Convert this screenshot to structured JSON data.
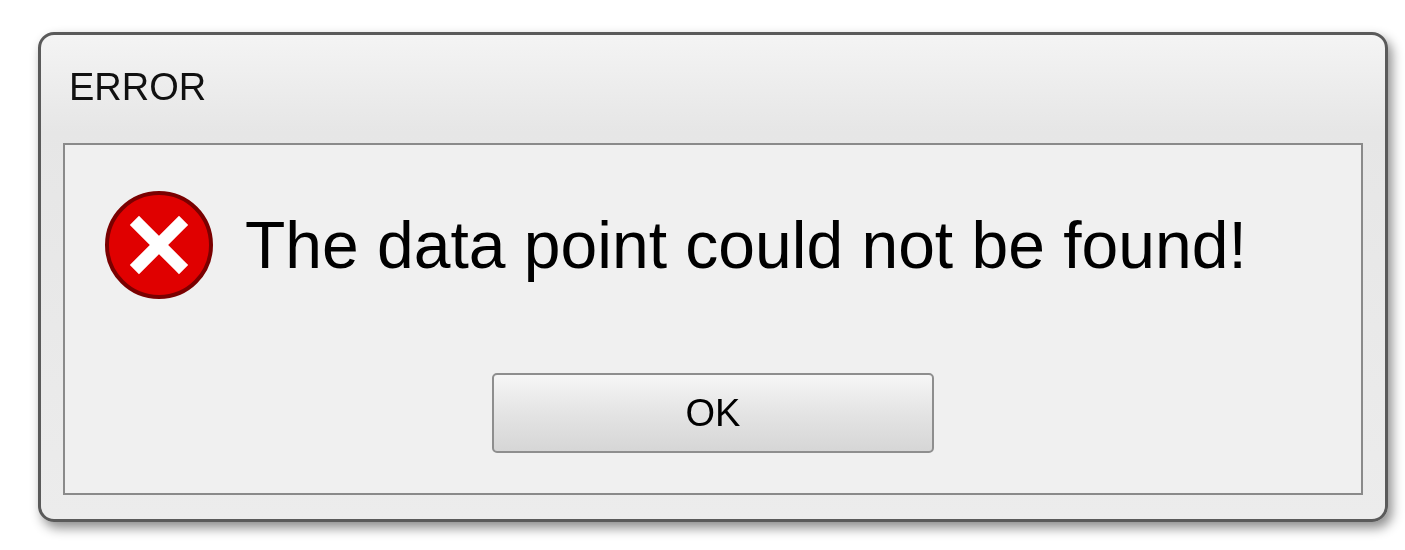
{
  "window": {
    "title": "ERROR"
  },
  "message": "The data point could not be found!",
  "buttons": [
    "OK"
  ]
}
